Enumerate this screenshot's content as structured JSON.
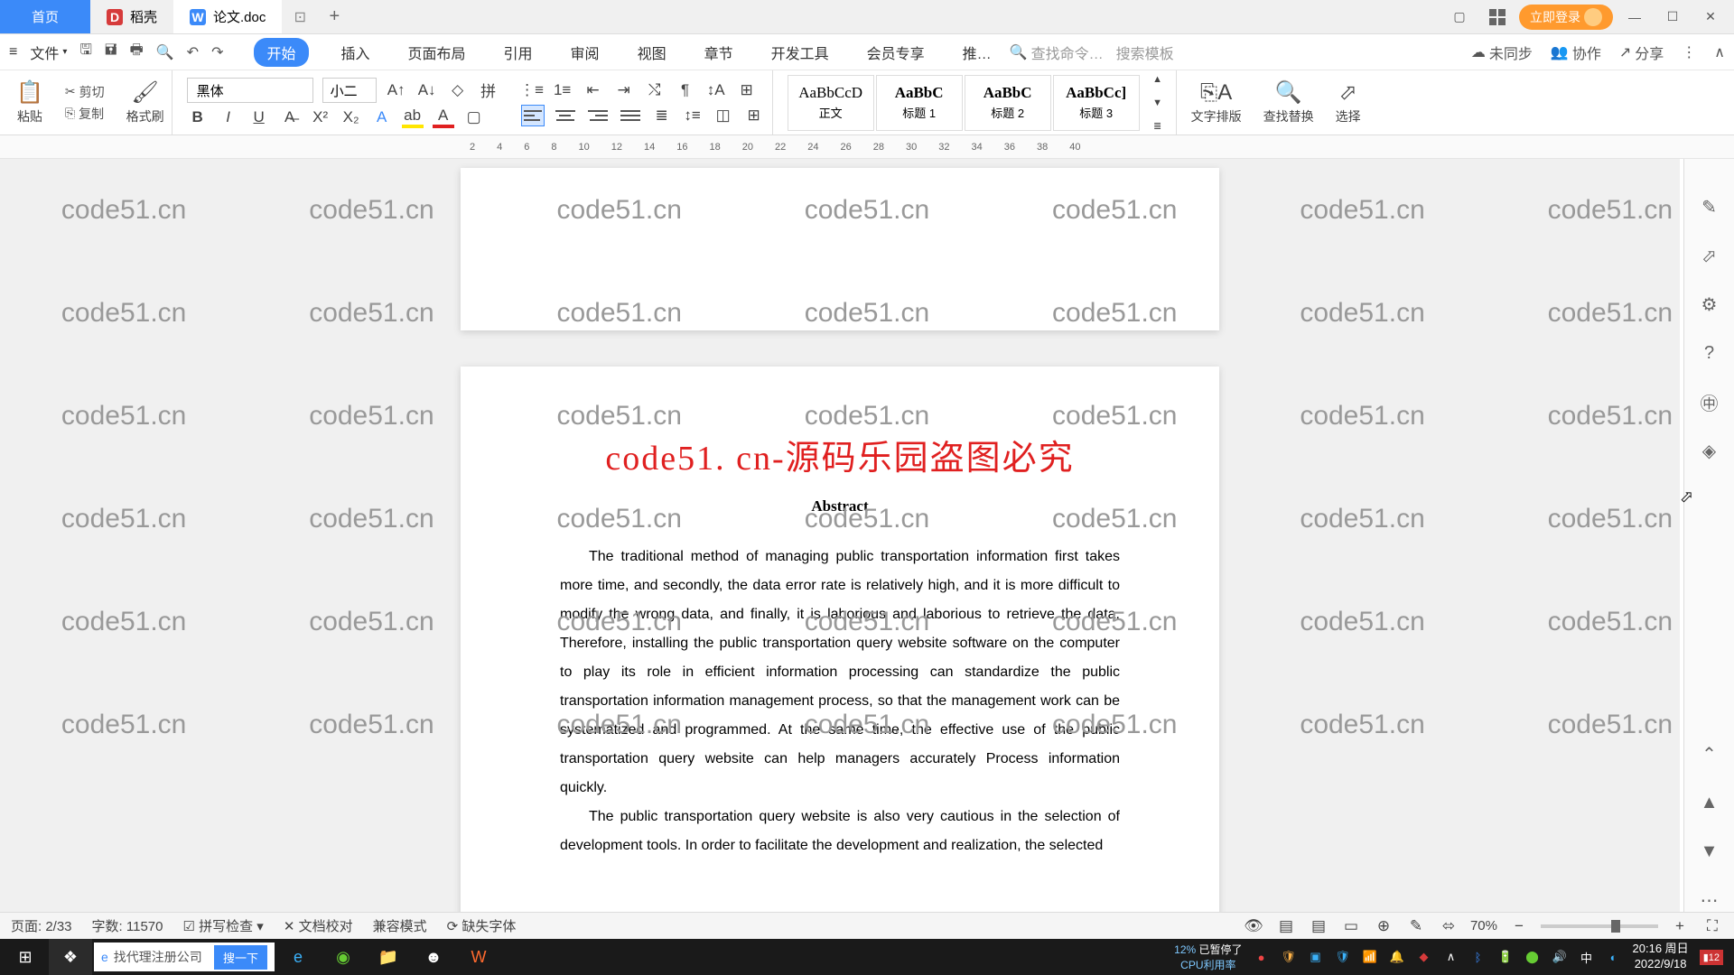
{
  "titlebar": {
    "tabs": {
      "home": "首页",
      "docshell": "稻壳",
      "doc": "论文.doc"
    },
    "add": "+",
    "login": "立即登录"
  },
  "menubar": {
    "file": "文件",
    "tabs": [
      "开始",
      "插入",
      "页面布局",
      "引用",
      "审阅",
      "视图",
      "章节",
      "开发工具",
      "会员专享",
      "推…"
    ],
    "search_cmd": "查找命令…",
    "search_tpl": "搜索模板",
    "right": {
      "unsync": "未同步",
      "collab": "协作",
      "share": "分享"
    }
  },
  "ribbon": {
    "paste": "粘贴",
    "cut": "剪切",
    "copy": "复制",
    "format_painter": "格式刷",
    "font_name": "黑体",
    "font_size": "小二",
    "styles": [
      {
        "preview": "AaBbCcD",
        "name": "正文"
      },
      {
        "preview": "AaBbC",
        "name": "标题 1"
      },
      {
        "preview": "AaBbC",
        "name": "标题 2"
      },
      {
        "preview": "AaBbCc]",
        "name": "标题 3"
      }
    ],
    "text_layout": "文字排版",
    "find_replace": "查找替换",
    "select": "选择"
  },
  "ruler": [
    "2",
    "4",
    "6",
    "8",
    "10",
    "12",
    "14",
    "16",
    "18",
    "20",
    "22",
    "24",
    "26",
    "28",
    "30",
    "32",
    "34",
    "36",
    "38",
    "40"
  ],
  "doc": {
    "title": "code51. cn-源码乐园盗图必究",
    "abstract": "Abstract",
    "body1": "The traditional method of managing public transportation information first takes more time, and secondly, the data error rate is relatively high, and it is more difficult to modify the wrong data, and finally, it is laborious and laborious to retrieve the data. Therefore, installing the public transportation query website software on the computer to play its role in efficient information processing can standardize the public transportation information management process, so that the management work can be systematized and programmed. At the same time, the effective use of the public transportation query website can help managers accurately Process information quickly.",
    "body2": "The public transportation query website is also very cautious in the selection of development tools. In order to facilitate the development and realization, the selected"
  },
  "watermark": "code51.cn",
  "statusbar": {
    "page": "页面: 2/33",
    "words": "字数: 11570",
    "spell": "拼写检查",
    "proof": "文档校对",
    "compat": "兼容模式",
    "missing_font": "缺失字体",
    "zoom": "70%"
  },
  "taskbar": {
    "search_ph": "找代理注册公司",
    "search_btn": "搜一下",
    "cpu_pct": "12%",
    "cpu_paused": "已暂停了",
    "cpu_label": "CPU利用率",
    "ime": "中",
    "time": "20:16 周日",
    "date": "2022/9/18",
    "notif": "12"
  }
}
